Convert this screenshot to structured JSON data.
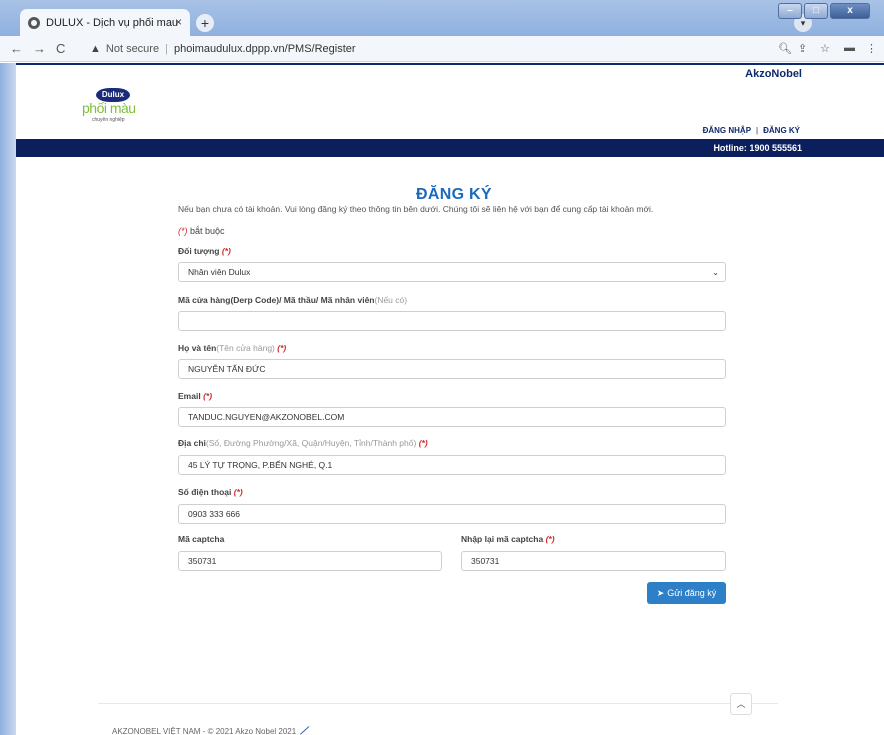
{
  "browser": {
    "tab_title": "DULUX - Dịch vụ phối mau",
    "tab_close": "×",
    "new_tab": "+",
    "url_warning": "Not secure",
    "url": "phoimaudulux.dppp.vn/PMS/Register"
  },
  "header": {
    "brand_top": "AkzoNobel",
    "logo_dulux": "Dulux",
    "logo_phoimau": "phối màu",
    "logo_sub": "chuyên nghiệp",
    "login_label": "ĐĂNG NHẬP",
    "register_label": "ĐĂNG KÝ",
    "nav_sep": "|",
    "hotline": "Hotline: 1900 555561"
  },
  "form": {
    "title": "ĐĂNG KÝ",
    "intro": "Nếu bạn chưa có tài khoản. Vui lòng đăng ký theo thông tin bên dưới. Chúng tôi sẽ liên hệ với bạn để cung cấp tài khoản mới.",
    "required_mark": "(*)",
    "required_text": " bắt buộc",
    "object_label": "Đối tượng",
    "object_value": "Nhân viên Dulux",
    "code_label": "Mã cửa hàng(Derp Code)/ Mã thầu/ Mã nhân viên",
    "code_hint": "(Nếu có)",
    "code_value": "",
    "name_label": "Họ và tên",
    "name_hint": "(Tên cửa hàng)",
    "name_value": "NGUYỄN TẤN ĐỨC",
    "email_label": "Email",
    "email_value": "TANDUC.NGUYEN@AKZONOBEL.COM",
    "address_label": "Địa chỉ",
    "address_hint": "(Số, Đường Phường/Xã, Quận/Huyện, Tỉnh/Thành phố)",
    "address_value": "45 LÝ TỰ TRỌNG, P.BẾN NGHÉ, Q.1",
    "phone_label": "Số điện thoại",
    "phone_value": "0903 333 666",
    "captcha_label": "Mã captcha",
    "captcha_value": "350731",
    "captcha_confirm_label": "Nhập lại mã captcha",
    "captcha_confirm_value": "350731",
    "submit_label": "Gửi đăng ký"
  },
  "footer": {
    "copyright": "AKZONOBEL VIỆT NAM - © 2021 Akzo Nobel 2021"
  }
}
